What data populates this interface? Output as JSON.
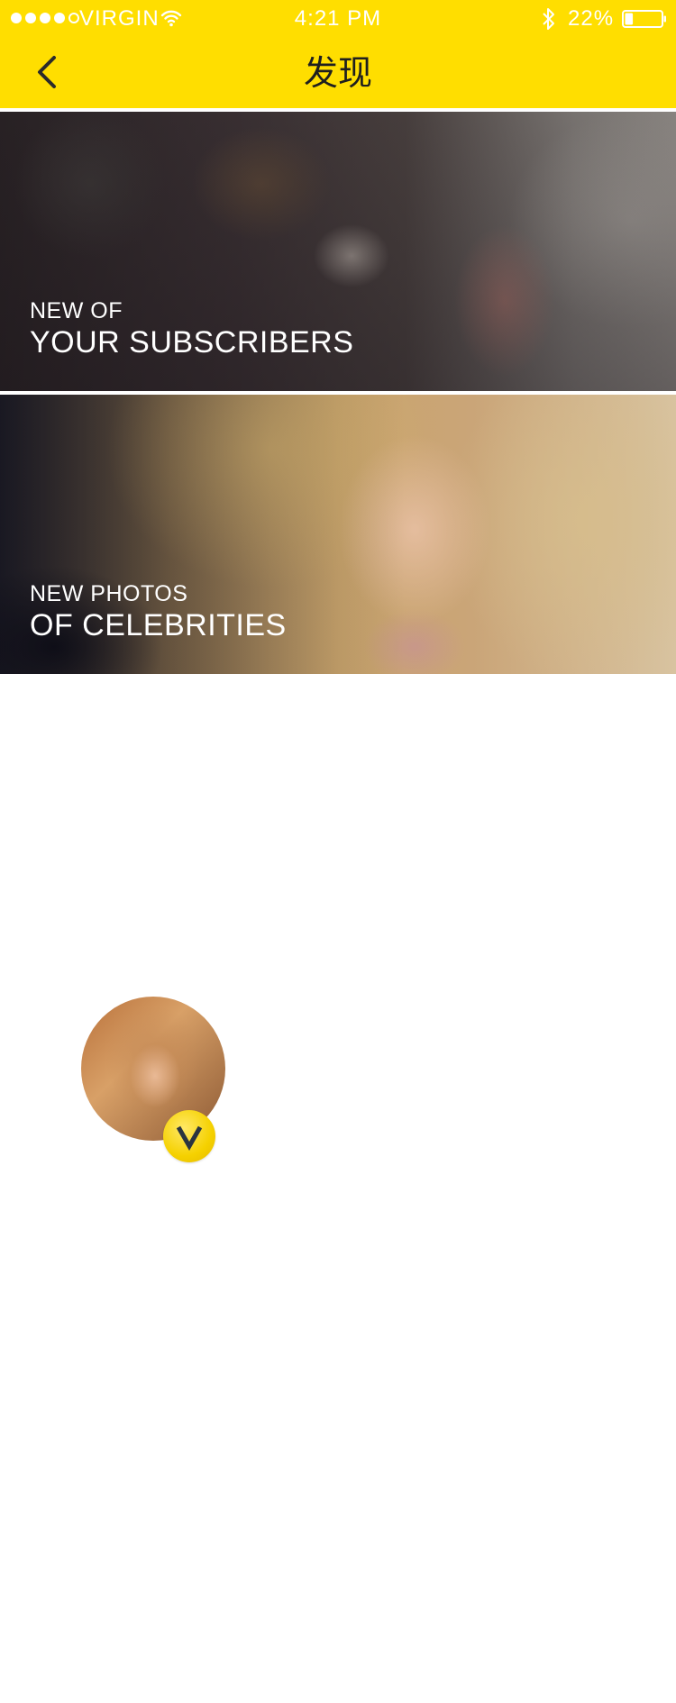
{
  "status_bar": {
    "carrier": "VIRGIN",
    "time": "4:21 PM",
    "battery": "22%",
    "signal_bars_filled": 4,
    "signal_bars_total": 5,
    "battery_level": 0.22,
    "icons": [
      "wifi-icon",
      "bluetooth-icon",
      "battery-icon"
    ]
  },
  "nav": {
    "title": "发现",
    "back_icon": "chevron-left-icon"
  },
  "banners": [
    {
      "line1": "NEW OF",
      "line2": "YOUR SUBSCRIBERS",
      "image": "concert-crowd-photo"
    },
    {
      "line1": "NEW PHOTOS",
      "line2": "OF CELEBRITIES",
      "image": "celebrity-portrait-photo"
    }
  ],
  "profile": {
    "avatar": "celebrity-avatar",
    "badge_letter": "V",
    "badge_icon": "verified-v-icon"
  },
  "colors": {
    "header": "#FFDE00",
    "background": "#FFFFFF",
    "badge": "#F5D100",
    "badge_letter": "#2A3440"
  }
}
